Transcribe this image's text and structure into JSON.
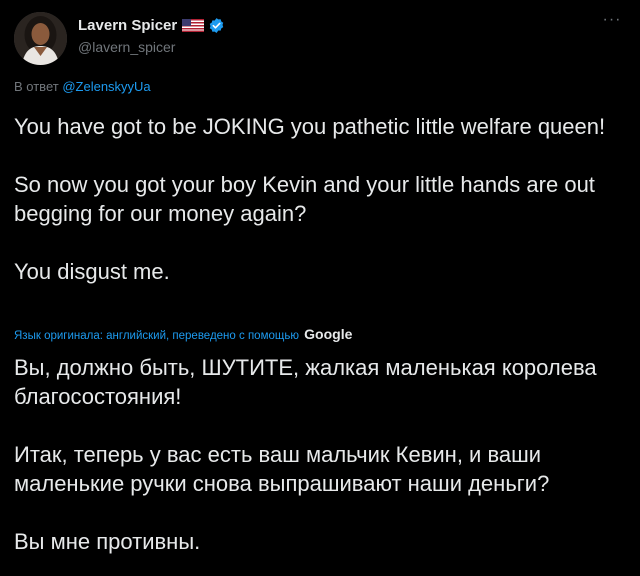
{
  "author": {
    "display_name": "Lavern Spicer",
    "handle": "@lavern_spicer",
    "flag_icon": "us-flag-icon",
    "verified_icon": "verified-badge-icon",
    "verified_color": "#1d9bf0"
  },
  "more_icon": "ellipsis-icon",
  "reply": {
    "prefix": "В ответ",
    "mention": "@ZelenskyyUa"
  },
  "original_text": [
    "You have got to be JOKING you pathetic little welfare queen!",
    "So now you got your boy Kevin and your little hands are out begging for our money again?",
    "You disgust me."
  ],
  "translation_note": {
    "label": "Язык оригинала: английский, переведено с помощью",
    "provider": "Google"
  },
  "translated_text": [
    "Вы, должно быть, ШУТИТЕ, жалкая маленькая королева благосостояния!",
    "Итак, теперь у вас есть ваш мальчик Кевин, и ваши маленькие ручки снова выпрашивают наши деньги?",
    "Вы мне противны."
  ],
  "colors": {
    "background": "#000000",
    "text": "#e7e9ea",
    "secondary": "#71767b",
    "accent": "#1d9bf0"
  }
}
